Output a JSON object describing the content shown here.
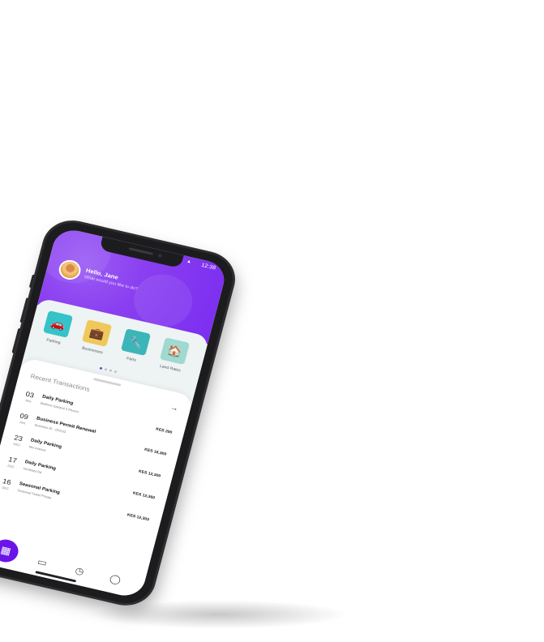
{
  "status": {
    "time": "12:38",
    "wifi_icon": "wifi-icon"
  },
  "greeting": {
    "title": "Hello, Jane",
    "subtitle": "What would you like to do?"
  },
  "services": [
    {
      "label": "Parking",
      "icon": "car-icon",
      "color": "#34c3c8"
    },
    {
      "label": "Businesses",
      "icon": "briefcase-icon",
      "color": "#f0c85a"
    },
    {
      "label": "Parts",
      "icon": "wrench-icon",
      "color": "#3bb6b8"
    },
    {
      "label": "Land Rates",
      "icon": "house-icon",
      "color": "#9fd9d1"
    }
  ],
  "recent": {
    "title": "Recent Transactions"
  },
  "transactions": [
    {
      "day": "03",
      "month": "JAN",
      "title": "Daily Parking",
      "sub": "Beehive Garland 3 Person",
      "amount": "KES 200"
    },
    {
      "day": "09",
      "month": "JAN",
      "title": "Business Permit Renewal",
      "sub": "Business ID - 192133",
      "amount": "KES 16,300"
    },
    {
      "day": "23",
      "month": "DEC",
      "title": "Daily Parking",
      "sub": "Moi Avenue",
      "amount": "KES 12,300"
    },
    {
      "day": "17",
      "month": "DEC",
      "title": "Daily Parking",
      "sub": "Hombeta Rd",
      "amount": "KES 12,360"
    },
    {
      "day": "16",
      "month": "DEC",
      "title": "Seasonal Parking",
      "sub": "Seasonal Ticket Private",
      "amount": "KES 12,303"
    }
  ],
  "tabs": [
    {
      "name": "home",
      "icon": "grid-icon",
      "active": true
    },
    {
      "name": "files",
      "icon": "folder-icon",
      "active": false
    },
    {
      "name": "history",
      "icon": "clock-icon",
      "active": false
    },
    {
      "name": "profile",
      "icon": "user-icon",
      "active": false
    }
  ],
  "colors": {
    "accent": "#7b2ef0",
    "tab_active": "#6a14e8"
  }
}
